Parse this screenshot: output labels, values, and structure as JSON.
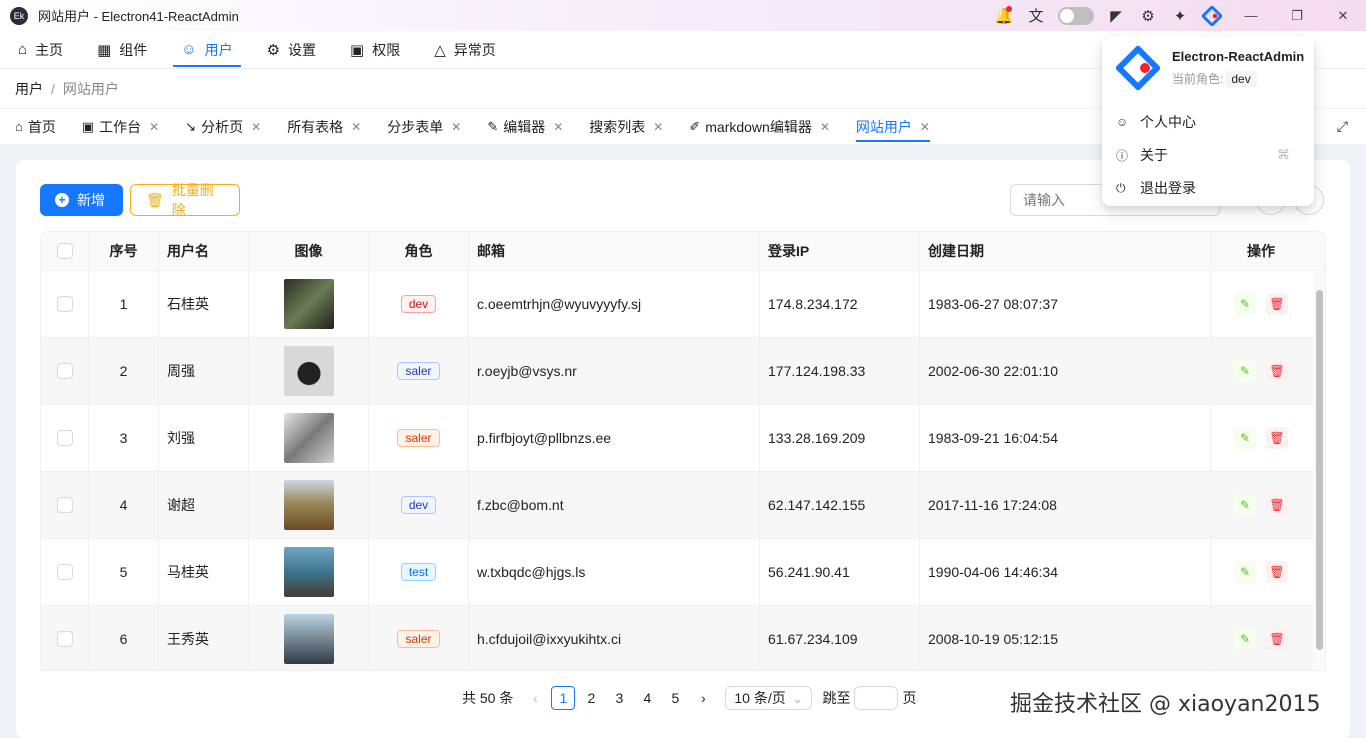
{
  "window": {
    "title": "网站用户 - Electron41-ReactAdmin",
    "logo_text": "Ek"
  },
  "topmenu": {
    "items": [
      {
        "label": "主页",
        "icon": "home-icon"
      },
      {
        "label": "组件",
        "icon": "grid-icon"
      },
      {
        "label": "用户",
        "icon": "user-icon"
      },
      {
        "label": "设置",
        "icon": "gear-icon"
      },
      {
        "label": "权限",
        "icon": "lock-icon"
      },
      {
        "label": "异常页",
        "icon": "alarm-icon"
      }
    ],
    "active": "用户"
  },
  "breadcrumb": {
    "parent": "用户",
    "sep": "/",
    "current": "网站用户"
  },
  "tabs": [
    {
      "label": "首页",
      "icon": "home-icon",
      "closable": false
    },
    {
      "label": "工作台",
      "icon": "monitor-icon",
      "closable": true
    },
    {
      "label": "分析页",
      "icon": "line-chart-icon",
      "closable": true
    },
    {
      "label": "所有表格",
      "icon": "",
      "closable": true
    },
    {
      "label": "分步表单",
      "icon": "",
      "closable": true
    },
    {
      "label": "编辑器",
      "icon": "edit-icon",
      "closable": true
    },
    {
      "label": "搜索列表",
      "icon": "",
      "closable": true
    },
    {
      "label": "markdown编辑器",
      "icon": "highlight-icon",
      "closable": true
    },
    {
      "label": "网站用户",
      "icon": "",
      "closable": true,
      "active": true
    }
  ],
  "toolbar": {
    "add_label": "新增",
    "batch_delete_label": "批量删除",
    "search_placeholder": "请输入"
  },
  "table": {
    "headers": [
      "序号",
      "用户名",
      "图像",
      "角色",
      "邮箱",
      "登录IP",
      "创建日期",
      "操作"
    ],
    "rows": [
      {
        "index": "1",
        "name": "石桂英",
        "role": "dev",
        "role_style": "dev",
        "email": "c.oeemtrhjn@wyuvyyyfy.sj",
        "ip": "174.8.234.172",
        "date": "1983-06-27 08:07:37",
        "thumb": "linear-gradient(135deg,#2a2f22,#6b7a55 50%,#1e2216)"
      },
      {
        "index": "2",
        "name": "周强",
        "role": "saler",
        "role_style": "saler-blue",
        "email": "r.oeyjb@vsys.nr",
        "ip": "177.124.198.33",
        "date": "2002-06-30 22:01:10",
        "thumb": "radial-gradient(circle at 50% 55%,#222 0 30%,#d8d8d8 32% 100%)"
      },
      {
        "index": "3",
        "name": "刘强",
        "role": "saler",
        "role_style": "saler",
        "email": "p.firfbjoyt@pllbnzs.ee",
        "ip": "133.28.169.209",
        "date": "1983-09-21 16:04:54",
        "thumb": "linear-gradient(135deg,#e6e6e6,#7a7a7a 50%,#d0d0d0)"
      },
      {
        "index": "4",
        "name": "谢超",
        "role": "dev",
        "role_style": "dev-blue",
        "email": "f.zbc@bom.nt",
        "ip": "62.147.142.155",
        "date": "2017-11-16 17:24:08",
        "thumb": "linear-gradient(180deg,#c9d8e8 0%,#9c8a5a 45%,#6b4a25 100%)"
      },
      {
        "index": "5",
        "name": "马桂英",
        "role": "test",
        "role_style": "test",
        "email": "w.txbqdc@hjgs.ls",
        "ip": "56.241.90.41",
        "date": "1990-04-06 14:46:34",
        "thumb": "linear-gradient(180deg,#6fa8c6 0%,#3b6f86 55%,#4a3b30 100%)"
      },
      {
        "index": "6",
        "name": "王秀英",
        "role": "saler",
        "role_style": "saler",
        "email": "h.cfdujoil@ixxyukihtx.ci",
        "ip": "61.67.234.109",
        "date": "2008-10-19 05:12:15",
        "thumb": "linear-gradient(180deg,#b9d3e6 0%,#7d8e9a 45%,#2f3a44 100%)"
      }
    ]
  },
  "pagination": {
    "total": "共 50 条",
    "pages": [
      "1",
      "2",
      "3",
      "4",
      "5"
    ],
    "current": "1",
    "page_size": "10 条/页",
    "jump_label": "跳至",
    "page_suffix": "页"
  },
  "dropdown": {
    "app_name": "Electron-ReactAdmin",
    "role_label": "当前角色:",
    "role": "dev",
    "items": [
      {
        "label": "个人中心",
        "icon": "user-icon"
      },
      {
        "label": "关于",
        "icon": "info-icon",
        "shortcut_icon": "command-icon"
      },
      {
        "label": "退出登录",
        "icon": "power-icon"
      }
    ]
  },
  "watermark": "掘金技术社区 @ xiaoyan2015",
  "colors": {
    "accent": "#1677ff",
    "warn": "#faad14",
    "danger": "#f5222d",
    "success": "#52c41a"
  }
}
